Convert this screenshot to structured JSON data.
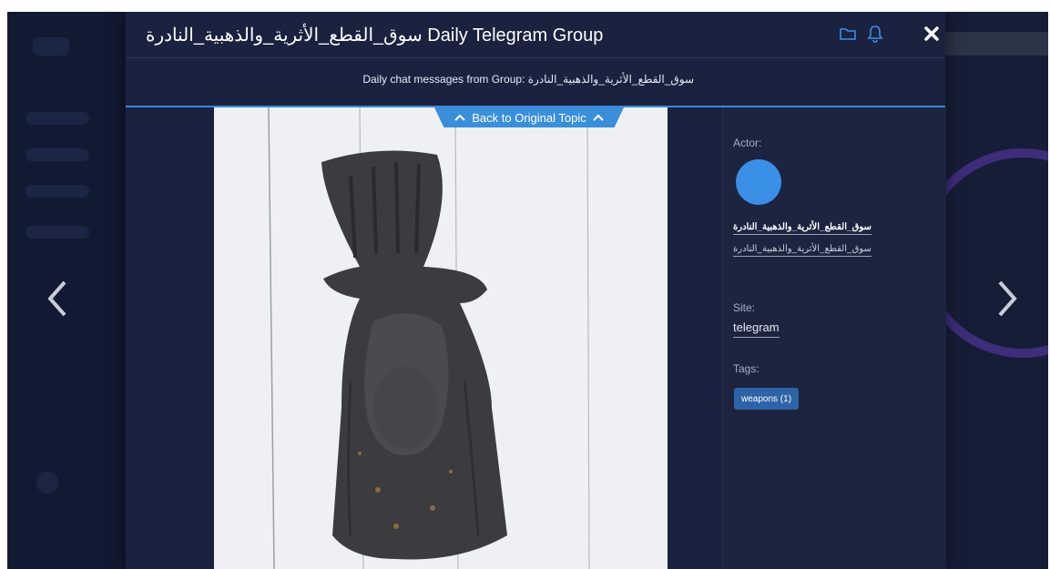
{
  "modal": {
    "title": "سوق_القطع_الأثرية_والذهبية_النادرة Daily Telegram Group",
    "subtitle": "Daily chat messages from Group: سوق_القطع_الأثرية_والذهبية_النادرة",
    "back_button_label": "Back to Original Topic"
  },
  "header_icons": [
    "folder-icon",
    "bell-icon",
    "close-icon"
  ],
  "side_panel": {
    "actor_label": "Actor:",
    "actor_name": "سوق_القطع_الأثرية_والذهبية_النادرة",
    "actor_handle": "سوق_القطع_الأثرية_والذهبية_النادرة",
    "site_label": "Site:",
    "site_value": "telegram",
    "tags_label": "Tags:",
    "tags": [
      {
        "label": "weapons (1)"
      }
    ]
  },
  "colors": {
    "accent": "#3a8fdb",
    "modal_bg": "#1c2440",
    "tag_bg": "#2e64a7",
    "avatar": "#3a8fe6"
  }
}
